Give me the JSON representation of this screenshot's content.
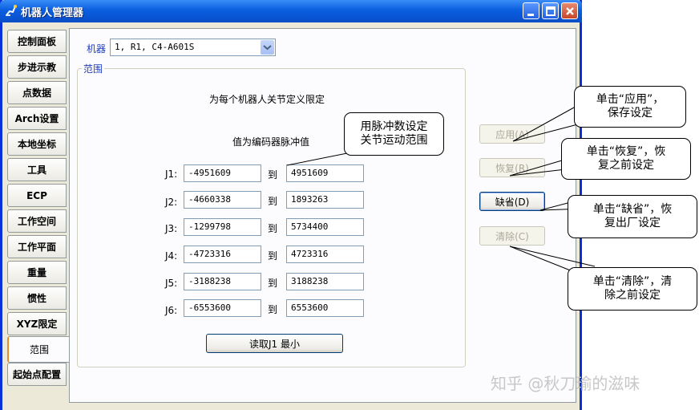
{
  "window": {
    "title": "机器人管理器"
  },
  "tabs": [
    "控制面板",
    "步进示教",
    "点数据",
    "Arch设置",
    "本地坐标",
    "工具",
    "ECP",
    "工作空间",
    "工作平面",
    "重量",
    "惯性",
    "XYZ限定",
    "范围",
    "起始点配置"
  ],
  "active_tab": "范围",
  "robot": {
    "label": "机器",
    "value": "1, R1, C4-A601S"
  },
  "range_group": {
    "title": "范围",
    "heading": "为每个机器人关节定义限定",
    "subheading": "值为编码器脉冲值",
    "to_label": "到",
    "joints": [
      {
        "label": "J1:",
        "min": "-4951609",
        "max": "4951609"
      },
      {
        "label": "J2:",
        "min": "-4660338",
        "max": "1893263"
      },
      {
        "label": "J3:",
        "min": "-1299798",
        "max": "5734400"
      },
      {
        "label": "J4:",
        "min": "-4723316",
        "max": "4723316"
      },
      {
        "label": "J5:",
        "min": "-3188238",
        "max": "3188238"
      },
      {
        "label": "J6:",
        "min": "-6553600",
        "max": "6553600"
      }
    ],
    "read_button": "读取J1 最小"
  },
  "buttons": {
    "apply": "应用(A)",
    "restore": "恢复(R)",
    "default": "缺省(D)",
    "clear": "清除(C)"
  },
  "callouts": {
    "pulse": "用脉冲数设定\n关节运动范围",
    "apply": "单击“应用”，\n保存设定",
    "restore": "单击“恢复”，恢\n复之前设定",
    "default": "单击“缺省”，恢\n复出厂设定",
    "clear": "单击“清除”，清\n除之前设定"
  },
  "watermark": "知乎 @秋刀瑜的滋味"
}
